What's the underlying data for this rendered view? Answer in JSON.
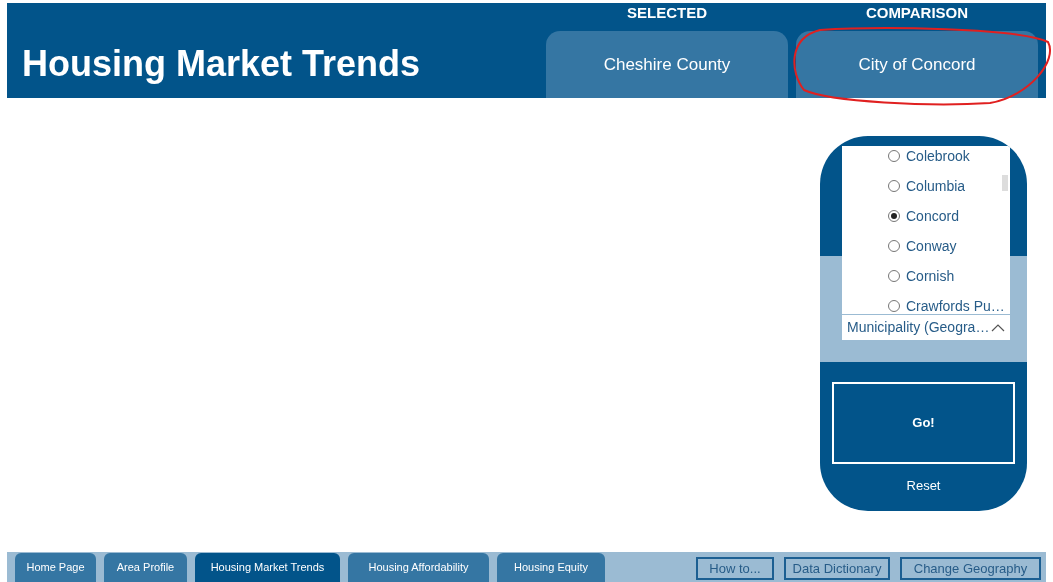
{
  "header": {
    "title": "Housing Market Trends",
    "geographies": [
      {
        "label": "SELECTED",
        "value": "Cheshire County"
      },
      {
        "label": "COMPARISON",
        "value": "City of Concord"
      }
    ]
  },
  "annotation": {
    "kind": "circle",
    "color": "#e02020"
  },
  "slicer": {
    "options": [
      {
        "label": "Colebrook",
        "selected": false
      },
      {
        "label": "Columbia",
        "selected": false
      },
      {
        "label": "Concord",
        "selected": true
      },
      {
        "label": "Conway",
        "selected": false
      },
      {
        "label": "Cornish",
        "selected": false
      },
      {
        "label": "Crawfords Pu…",
        "selected": false
      }
    ],
    "field": "Municipality (Geogra…",
    "go": "Go!",
    "reset": "Reset"
  },
  "tabs": [
    {
      "label": "Home Page",
      "selected": false
    },
    {
      "label": "Area Profile",
      "selected": false
    },
    {
      "label": "Housing Market Trends",
      "selected": true
    },
    {
      "label": "Housing Affordability",
      "selected": false
    },
    {
      "label": "Housing Equity",
      "selected": false
    }
  ],
  "buttons": [
    "How to...",
    "Data Dictionary",
    "Change Geography"
  ]
}
